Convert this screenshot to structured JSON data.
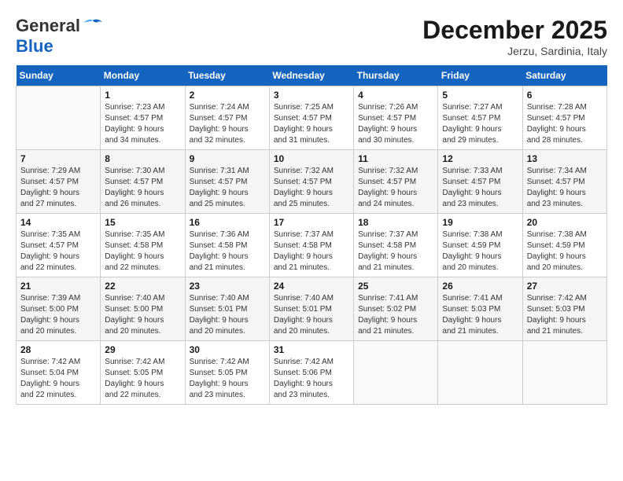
{
  "header": {
    "logo_general": "General",
    "logo_blue": "Blue",
    "month_title": "December 2025",
    "location": "Jerzu, Sardinia, Italy"
  },
  "days_of_week": [
    "Sunday",
    "Monday",
    "Tuesday",
    "Wednesday",
    "Thursday",
    "Friday",
    "Saturday"
  ],
  "weeks": [
    [
      {
        "day": "",
        "info": ""
      },
      {
        "day": "1",
        "info": "Sunrise: 7:23 AM\nSunset: 4:57 PM\nDaylight: 9 hours\nand 34 minutes."
      },
      {
        "day": "2",
        "info": "Sunrise: 7:24 AM\nSunset: 4:57 PM\nDaylight: 9 hours\nand 32 minutes."
      },
      {
        "day": "3",
        "info": "Sunrise: 7:25 AM\nSunset: 4:57 PM\nDaylight: 9 hours\nand 31 minutes."
      },
      {
        "day": "4",
        "info": "Sunrise: 7:26 AM\nSunset: 4:57 PM\nDaylight: 9 hours\nand 30 minutes."
      },
      {
        "day": "5",
        "info": "Sunrise: 7:27 AM\nSunset: 4:57 PM\nDaylight: 9 hours\nand 29 minutes."
      },
      {
        "day": "6",
        "info": "Sunrise: 7:28 AM\nSunset: 4:57 PM\nDaylight: 9 hours\nand 28 minutes."
      }
    ],
    [
      {
        "day": "7",
        "info": "Sunrise: 7:29 AM\nSunset: 4:57 PM\nDaylight: 9 hours\nand 27 minutes."
      },
      {
        "day": "8",
        "info": "Sunrise: 7:30 AM\nSunset: 4:57 PM\nDaylight: 9 hours\nand 26 minutes."
      },
      {
        "day": "9",
        "info": "Sunrise: 7:31 AM\nSunset: 4:57 PM\nDaylight: 9 hours\nand 25 minutes."
      },
      {
        "day": "10",
        "info": "Sunrise: 7:32 AM\nSunset: 4:57 PM\nDaylight: 9 hours\nand 25 minutes."
      },
      {
        "day": "11",
        "info": "Sunrise: 7:32 AM\nSunset: 4:57 PM\nDaylight: 9 hours\nand 24 minutes."
      },
      {
        "day": "12",
        "info": "Sunrise: 7:33 AM\nSunset: 4:57 PM\nDaylight: 9 hours\nand 23 minutes."
      },
      {
        "day": "13",
        "info": "Sunrise: 7:34 AM\nSunset: 4:57 PM\nDaylight: 9 hours\nand 23 minutes."
      }
    ],
    [
      {
        "day": "14",
        "info": "Sunrise: 7:35 AM\nSunset: 4:57 PM\nDaylight: 9 hours\nand 22 minutes."
      },
      {
        "day": "15",
        "info": "Sunrise: 7:35 AM\nSunset: 4:58 PM\nDaylight: 9 hours\nand 22 minutes."
      },
      {
        "day": "16",
        "info": "Sunrise: 7:36 AM\nSunset: 4:58 PM\nDaylight: 9 hours\nand 21 minutes."
      },
      {
        "day": "17",
        "info": "Sunrise: 7:37 AM\nSunset: 4:58 PM\nDaylight: 9 hours\nand 21 minutes."
      },
      {
        "day": "18",
        "info": "Sunrise: 7:37 AM\nSunset: 4:58 PM\nDaylight: 9 hours\nand 21 minutes."
      },
      {
        "day": "19",
        "info": "Sunrise: 7:38 AM\nSunset: 4:59 PM\nDaylight: 9 hours\nand 20 minutes."
      },
      {
        "day": "20",
        "info": "Sunrise: 7:38 AM\nSunset: 4:59 PM\nDaylight: 9 hours\nand 20 minutes."
      }
    ],
    [
      {
        "day": "21",
        "info": "Sunrise: 7:39 AM\nSunset: 5:00 PM\nDaylight: 9 hours\nand 20 minutes."
      },
      {
        "day": "22",
        "info": "Sunrise: 7:40 AM\nSunset: 5:00 PM\nDaylight: 9 hours\nand 20 minutes."
      },
      {
        "day": "23",
        "info": "Sunrise: 7:40 AM\nSunset: 5:01 PM\nDaylight: 9 hours\nand 20 minutes."
      },
      {
        "day": "24",
        "info": "Sunrise: 7:40 AM\nSunset: 5:01 PM\nDaylight: 9 hours\nand 20 minutes."
      },
      {
        "day": "25",
        "info": "Sunrise: 7:41 AM\nSunset: 5:02 PM\nDaylight: 9 hours\nand 21 minutes."
      },
      {
        "day": "26",
        "info": "Sunrise: 7:41 AM\nSunset: 5:03 PM\nDaylight: 9 hours\nand 21 minutes."
      },
      {
        "day": "27",
        "info": "Sunrise: 7:42 AM\nSunset: 5:03 PM\nDaylight: 9 hours\nand 21 minutes."
      }
    ],
    [
      {
        "day": "28",
        "info": "Sunrise: 7:42 AM\nSunset: 5:04 PM\nDaylight: 9 hours\nand 22 minutes."
      },
      {
        "day": "29",
        "info": "Sunrise: 7:42 AM\nSunset: 5:05 PM\nDaylight: 9 hours\nand 22 minutes."
      },
      {
        "day": "30",
        "info": "Sunrise: 7:42 AM\nSunset: 5:05 PM\nDaylight: 9 hours\nand 23 minutes."
      },
      {
        "day": "31",
        "info": "Sunrise: 7:42 AM\nSunset: 5:06 PM\nDaylight: 9 hours\nand 23 minutes."
      },
      {
        "day": "",
        "info": ""
      },
      {
        "day": "",
        "info": ""
      },
      {
        "day": "",
        "info": ""
      }
    ]
  ]
}
